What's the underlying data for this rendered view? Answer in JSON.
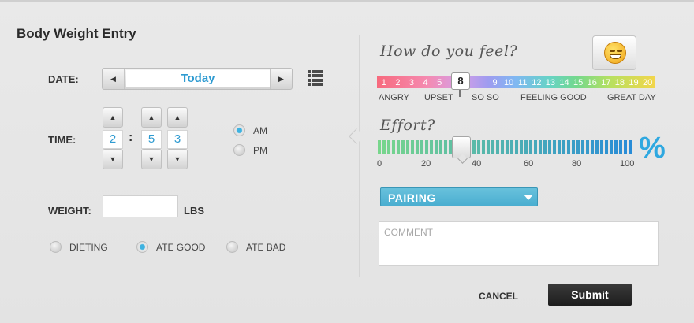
{
  "form": {
    "title": "Body Weight Entry"
  },
  "date": {
    "label": "DATE:",
    "value": "Today",
    "prev_icon": "chevron-left-icon",
    "next_icon": "chevron-right-icon",
    "calendar_icon": "calendar-grid-icon"
  },
  "time": {
    "label": "TIME:",
    "hour": "2",
    "separator": ":",
    "minute_tens": "5",
    "minute_ones": "3",
    "am_label": "AM",
    "pm_label": "PM",
    "selected": "AM"
  },
  "weight": {
    "label": "WEIGHT:",
    "value": "",
    "unit": "LBS"
  },
  "diet": {
    "options": [
      "DIETING",
      "ATE GOOD",
      "ATE BAD"
    ],
    "selected": "ATE GOOD"
  },
  "feel": {
    "title": "How do you feel?",
    "numbers": [
      "1",
      "2",
      "3",
      "4",
      "5",
      "6",
      "7",
      "8",
      "9",
      "10",
      "11",
      "12",
      "13",
      "14",
      "15",
      "16",
      "17",
      "18",
      "19",
      "20"
    ],
    "selected": "8",
    "labels": [
      "ANGRY",
      "UPSET",
      "SO SO",
      "FEELING GOOD",
      "GREAT DAY"
    ],
    "emoji_icon": "smiley-face-icon"
  },
  "effort": {
    "title": "Effort?",
    "ticks": [
      "0",
      "20",
      "40",
      "60",
      "80",
      "100"
    ],
    "value_percent": 33,
    "percent_symbol": "%"
  },
  "activity": {
    "selected": "PAIRING"
  },
  "comment": {
    "placeholder": "COMMENT",
    "value": ""
  },
  "actions": {
    "cancel": "CANCEL",
    "submit": "Submit"
  },
  "colors": {
    "accent": "#2fa8e0",
    "dropdown": "#5ab8d8",
    "submit": "#262626"
  }
}
